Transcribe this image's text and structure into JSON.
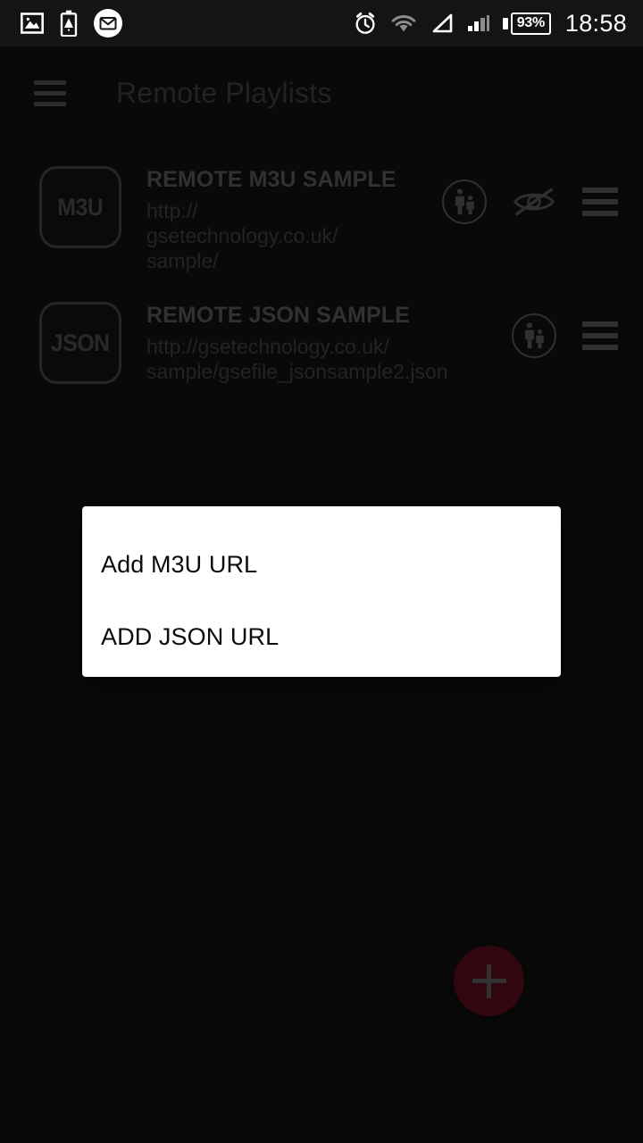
{
  "status_bar": {
    "icons_left": [
      "image-icon",
      "battery-alert-icon",
      "email-icon"
    ],
    "icons_right": [
      "alarm-icon",
      "wifi-icon",
      "signal-triangle-icon",
      "signal-bars-icon",
      "battery-icon"
    ],
    "battery_percent": "93%",
    "clock": "18:58"
  },
  "app_bar": {
    "menu_icon": "hamburger-menu-icon",
    "title": "Remote Playlists"
  },
  "playlists": [
    {
      "badge": "M3U",
      "title": "REMOTE M3U SAMPLE",
      "url": "http://\ngsetechnology.co.uk/\nsample/",
      "actions": [
        "parental-control-icon",
        "hidden-eye-icon",
        "drag-handle-icon"
      ]
    },
    {
      "badge": "JSON",
      "title": "REMOTE JSON SAMPLE",
      "url": "http://gsetechnology.co.uk/\nsample/gsefile_jsonsample2.json",
      "actions": [
        "parental-control-icon",
        "drag-handle-icon"
      ]
    }
  ],
  "fab": {
    "icon": "plus-icon",
    "color": "#6d0e23"
  },
  "dialog": {
    "options": [
      {
        "label": "Add M3U URL"
      },
      {
        "label": "ADD JSON URL"
      }
    ],
    "background": "#ffffff"
  }
}
